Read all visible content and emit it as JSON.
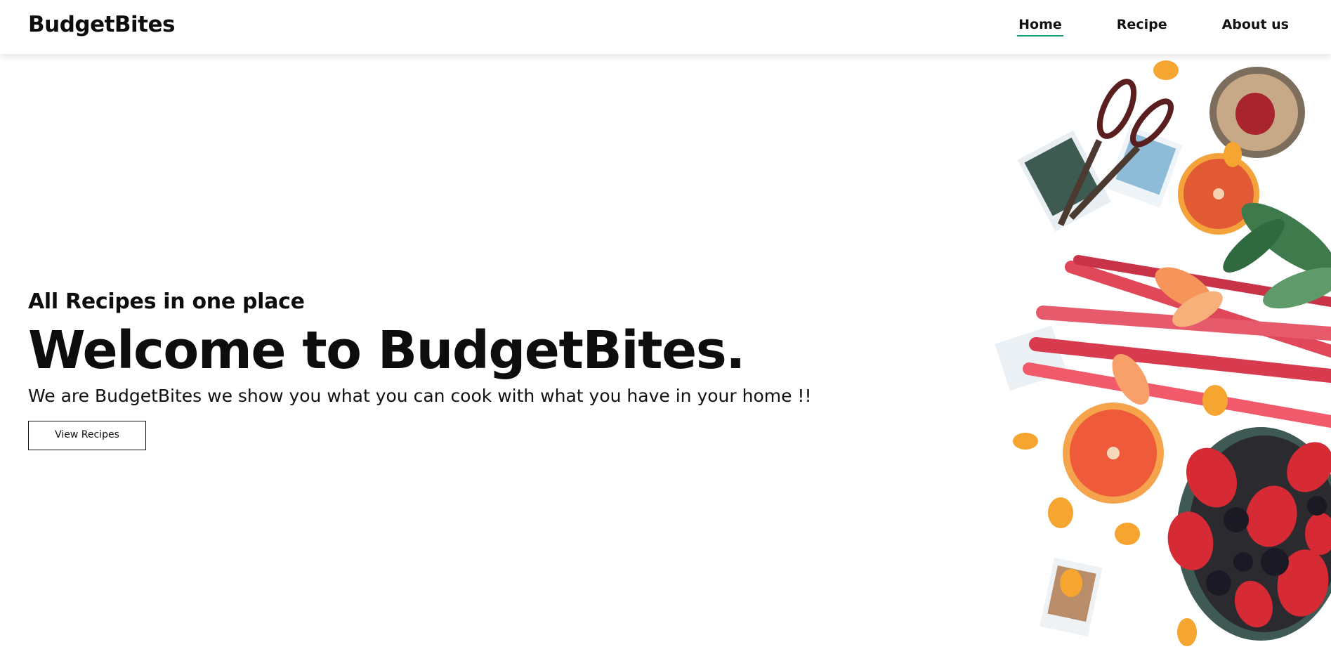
{
  "brand": {
    "name": "BudgetBites"
  },
  "nav": {
    "items": [
      {
        "label": "Home",
        "active": true
      },
      {
        "label": "Recipe",
        "active": false
      },
      {
        "label": "About us",
        "active": false
      }
    ],
    "active_color": "#1aa37a"
  },
  "hero": {
    "kicker": "All Recipes in one place",
    "headline": "Welcome to BudgetBites.",
    "tagline": "We are BudgetBites we show you what you can cook with what you have in your home !!",
    "cta_label": "View Recipes"
  }
}
